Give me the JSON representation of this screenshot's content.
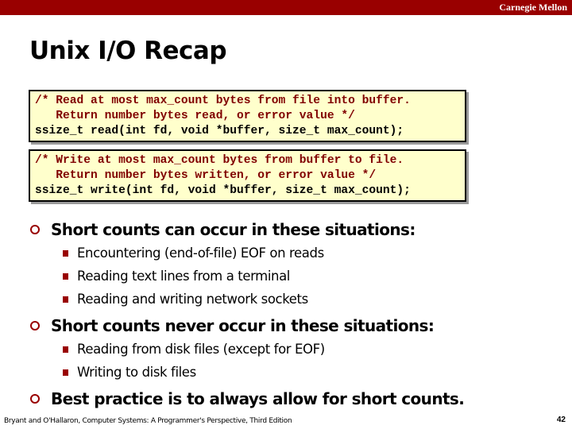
{
  "header": {
    "brand": "Carnegie Mellon"
  },
  "title": "Unix I/O Recap",
  "code_blocks": [
    {
      "comment_line1": "/* Read at most max_count bytes from file into buffer.",
      "comment_line2": "   Return number bytes read, or error value */",
      "code_line": "ssize_t read(int fd, void *buffer, size_t max_count);"
    },
    {
      "comment_line1": "/* Write at most max_count bytes from buffer to file.",
      "comment_line2": "   Return number bytes written, or error value */",
      "code_line": "ssize_t write(int fd, void *buffer, size_t max_count);"
    }
  ],
  "bullets": [
    {
      "text": "Short counts can occur in these situations:",
      "sub": [
        "Encountering (end-of-file) EOF on reads",
        "Reading text lines from a terminal",
        "Reading and writing network sockets"
      ]
    },
    {
      "text": "Short counts never occur in these situations:",
      "sub": [
        "Reading from disk files (except for EOF)",
        "Writing to disk files"
      ]
    },
    {
      "text": "Best practice is to always allow for short counts.",
      "sub": []
    }
  ],
  "footer": {
    "citation": "Bryant and O'Hallaron, Computer Systems: A Programmer's Perspective, Third Edition",
    "page_number": "42"
  },
  "colors": {
    "accent": "#990000",
    "code_bg": "#ffffcc",
    "comment": "#800000"
  }
}
